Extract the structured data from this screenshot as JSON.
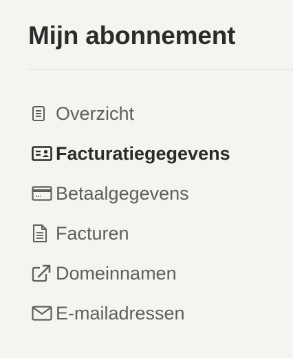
{
  "page": {
    "title": "Mijn abonnement"
  },
  "nav": {
    "items": [
      {
        "label": "Overzicht",
        "icon": "document-list-icon",
        "active": false
      },
      {
        "label": "Facturatiegegevens",
        "icon": "id-card-icon",
        "active": true
      },
      {
        "label": "Betaalgegevens",
        "icon": "credit-card-icon",
        "active": false
      },
      {
        "label": "Facturen",
        "icon": "file-text-icon",
        "active": false
      },
      {
        "label": "Domeinnamen",
        "icon": "external-link-icon",
        "active": false
      },
      {
        "label": "E-mailadressen",
        "icon": "envelope-icon",
        "active": false
      }
    ]
  },
  "colors": {
    "background": "#f5f4ef",
    "title": "#2b2b2b",
    "text": "#5e5e5e",
    "divider": "#dcdbd6"
  }
}
